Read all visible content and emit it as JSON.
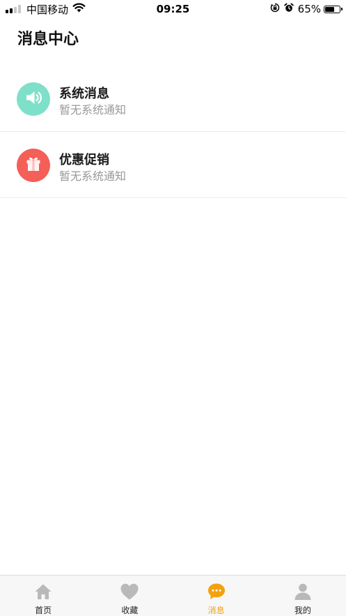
{
  "status_bar": {
    "carrier": "中国移动",
    "time": "09:25",
    "battery_percent": "65%",
    "battery_level": 0.65,
    "signal_bars_on": 2,
    "signal_bars_total": 4
  },
  "page": {
    "title": "消息中心"
  },
  "messages": [
    {
      "title": "系统消息",
      "subtitle": "暂无系统通知",
      "icon": "speaker-icon",
      "color": "#7fe0c9"
    },
    {
      "title": "优惠促销",
      "subtitle": "暂无系统通知",
      "icon": "gift-icon",
      "color": "#f45f58"
    }
  ],
  "tab_bar": {
    "active_color": "#f2a20c",
    "inactive_color": "#b9b9b9",
    "tabs": [
      {
        "label": "首页",
        "icon": "home-icon",
        "active": false
      },
      {
        "label": "收藏",
        "icon": "heart-icon",
        "active": false
      },
      {
        "label": "消息",
        "icon": "chat-bubble-icon",
        "active": true
      },
      {
        "label": "我的",
        "icon": "user-icon",
        "active": false
      }
    ]
  }
}
